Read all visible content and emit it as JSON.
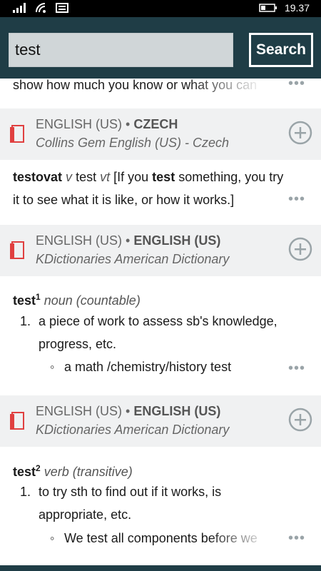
{
  "status": {
    "time": "19.37"
  },
  "search": {
    "value": "test",
    "button_label": "Search"
  },
  "top_partial": {
    "text": "show how much you know or what you can"
  },
  "entries": [
    {
      "source_lang": "ENGLISH (US)",
      "target_lang": "CZECH",
      "dictionary": "Collins Gem English (US) - Czech",
      "headword": "testovat",
      "pos": "v",
      "gloss_word": "test",
      "gloss_pos": "vt",
      "definition_a": "[If you",
      "definition_bold": "test",
      "definition_b": "something, you try",
      "definition_line2": "it to see what it is like, or how it works.]"
    },
    {
      "source_lang": "ENGLISH (US)",
      "target_lang": "ENGLISH (US)",
      "dictionary": "KDictionaries American Dictionary",
      "headword": "test",
      "sup": "1",
      "pos": "noun (countable)",
      "sense_num": "1.",
      "sense_line1": "a piece of work to assess sb's knowledge,",
      "sense_line2": "progress, etc.",
      "example": "a math /chemistry/history test"
    },
    {
      "source_lang": "ENGLISH (US)",
      "target_lang": "ENGLISH (US)",
      "dictionary": "KDictionaries American Dictionary",
      "headword": "test",
      "sup": "2",
      "pos": "verb (transitive)",
      "sense_num": "1.",
      "sense_line1": "to try sth to find out if it works, is",
      "sense_line2": "appropriate, etc.",
      "example": "We test all components before we"
    }
  ],
  "colors": {
    "header": "#1f3d46",
    "accent_red": "#e04040",
    "muted": "#9aa4a8"
  }
}
